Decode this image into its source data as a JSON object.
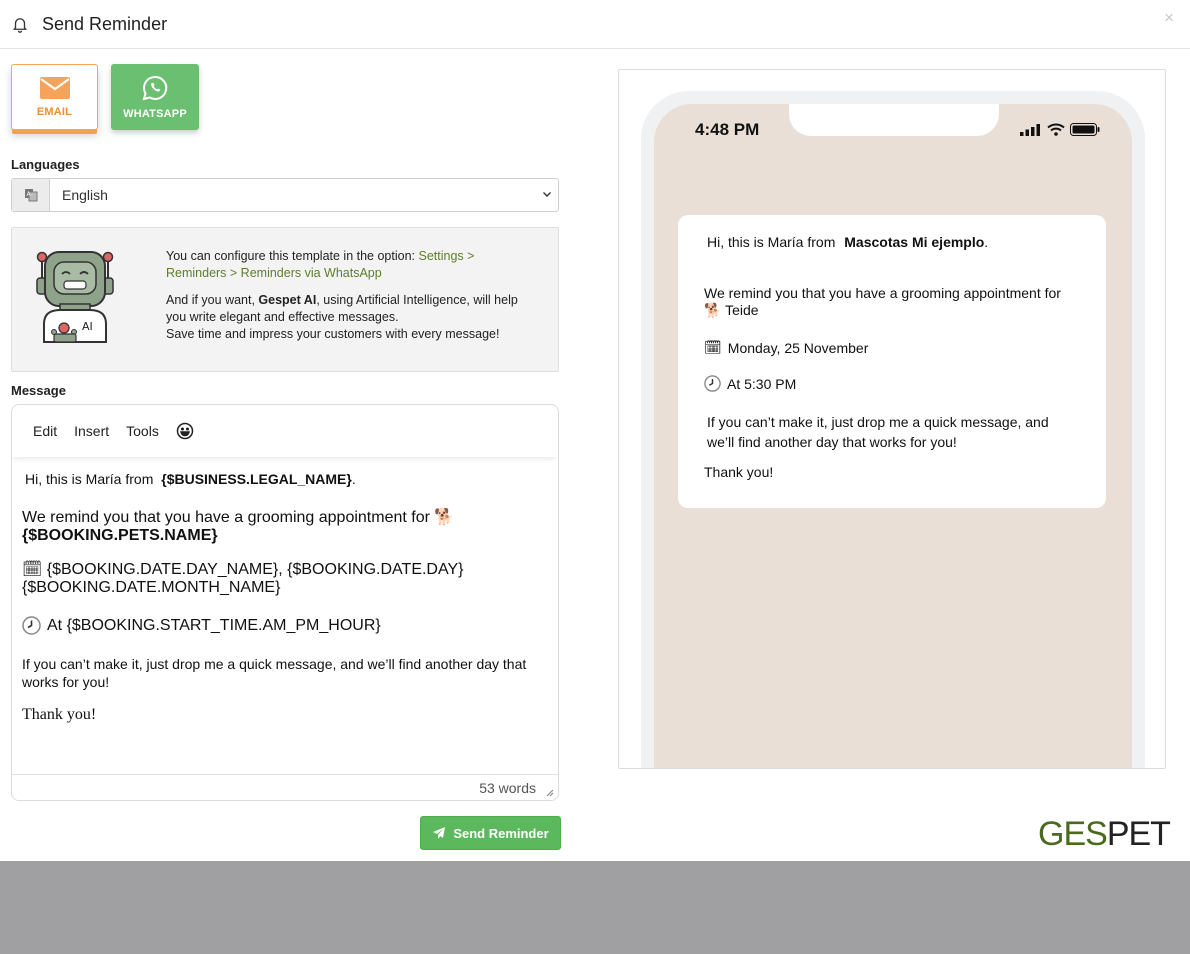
{
  "header": {
    "title": "Send Reminder",
    "close": "×"
  },
  "channels": [
    {
      "label": "EMAIL",
      "active": true,
      "icon": "envelope-icon"
    },
    {
      "label": "WHATSAPP",
      "active": false,
      "icon": "whatsapp-icon"
    }
  ],
  "languages": {
    "label": "Languages",
    "value": "English"
  },
  "info": {
    "line1_prefix": "You can configure this template in the option: ",
    "line1_link": "Settings > Reminders > Reminders via WhatsApp",
    "p2_prefix": "And if you want, ",
    "p2_brand": "Gespet AI",
    "p2_rest": ", using Artificial Intelligence, will help you write elegant and effective messages.",
    "p3": "Save time and impress your customers with every message!",
    "robot_badge": "AI"
  },
  "message": {
    "label": "Message",
    "menu": {
      "edit": "Edit",
      "insert": "Insert",
      "tools": "Tools"
    },
    "greeting_prefix": "Hi, this is María from",
    "greeting_var": "{$BUSINESS.LEGAL_NAME}",
    "greeting_end": ".",
    "remind_text": "We remind you that you have a grooming appointment for",
    "pet_emoji": "🐕",
    "pets_var": "{$BOOKING.PETS.NAME}",
    "calendar_emoji": "🗓",
    "date_text": "{$BOOKING.DATE.DAY_NAME}, {$BOOKING.DATE.DAY} {$BOOKING.DATE.MONTH_NAME}",
    "clock_emoji": "🕓",
    "time_text": "At {$BOOKING.START_TIME.AM_PM_HOUR}",
    "closing": "If you can’t make it, just drop me a quick message, and we’ll find another day that works for you!",
    "thanks": "Thank you!",
    "word_count": "53 words"
  },
  "send_button": "Send Reminder",
  "preview": {
    "time": "4:48 PM",
    "greeting_prefix": "Hi, this is María from",
    "business": "Mascotas Mi ejemplo",
    "greeting_end": ".",
    "remind_text": "We remind you that you have a grooming appointment for",
    "pet_emoji": "🐕",
    "pet": "Teide",
    "calendar_emoji": "🗓",
    "date": "Monday, 25 November",
    "clock_emoji": "🕓",
    "time_text": "At 5:30 PM",
    "closing": "If you can’t make it, just drop me a quick message, and we’ll find  another day that works for you!",
    "thanks": "Thank you!"
  },
  "brand": {
    "part1": "GES",
    "part2": "PET"
  },
  "colors": {
    "accent_orange": "#f08d2c",
    "whatsapp_green": "#6ac070",
    "send_green": "#5cb85c",
    "link_green": "#5e7e2a"
  }
}
